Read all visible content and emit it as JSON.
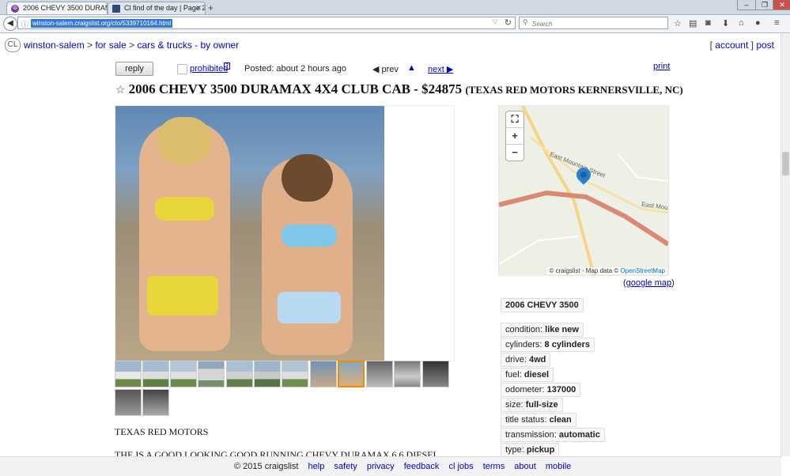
{
  "browser": {
    "tabs": [
      {
        "title": "2006 CHEVY 3500 DURAM...",
        "active": true
      },
      {
        "title": "Cl find of the day | Page 2 |...",
        "active": false
      }
    ],
    "new_tab": "+",
    "url": "winston-salem.craigslist.org/cto/5339710164.html",
    "search_placeholder": "Search",
    "window_controls": [
      "–",
      "❐",
      "✕"
    ]
  },
  "header": {
    "logo": "CL",
    "breadcrumb": [
      "winston-salem",
      ">",
      "for sale",
      ">",
      "cars & trucks - by owner"
    ],
    "account": "account",
    "post": "post"
  },
  "toolbar": {
    "reply_label": "reply",
    "prohibited_label": "prohibited",
    "help_label": "?",
    "posted": "Posted: about 2 hours ago",
    "prev_label": "prev",
    "up_label": "▲",
    "next_label": "next ▶",
    "print_label": "print"
  },
  "posting": {
    "title": "2006 CHEVY 3500 DURAMAX 4X4 CLUB CAB - $24875",
    "location": "(TEXAS RED MOTORS KERNERSVILLE, NC)",
    "body_line1": "TEXAS RED MOTORS",
    "body_line2": "THE IS A GOOD LOOKING GOOD RUNNING CHEVY DURAMAX 6.6 DIESEL"
  },
  "map": {
    "credit": "© craigslist - Map data ©",
    "osm": "OpenStreetMap",
    "street1": "East Mountain Street",
    "street2": "East Mou",
    "google_map_prefix": "(",
    "google_map": "google map",
    "google_map_suffix": ")"
  },
  "attributes": {
    "heading": "2006 CHEVY 3500",
    "items": [
      {
        "key": "condition: ",
        "value": "like new"
      },
      {
        "key": "cylinders: ",
        "value": "8 cylinders"
      },
      {
        "key": "drive: ",
        "value": "4wd"
      },
      {
        "key": "fuel: ",
        "value": "diesel"
      },
      {
        "key": "odometer: ",
        "value": "137000"
      },
      {
        "key": "size: ",
        "value": "full-size"
      },
      {
        "key": "title status: ",
        "value": "clean"
      },
      {
        "key": "transmission: ",
        "value": "automatic"
      },
      {
        "key": "type: ",
        "value": "pickup"
      }
    ]
  },
  "footer": {
    "copyright": "© 2015 craigslist",
    "links": [
      "help",
      "safety",
      "privacy",
      "feedback",
      "cl jobs",
      "terms",
      "about",
      "mobile"
    ]
  },
  "colors": {
    "link": "#0000cc",
    "selected_thumb": "#f28b00",
    "map_pin": "#2b7fcf"
  }
}
